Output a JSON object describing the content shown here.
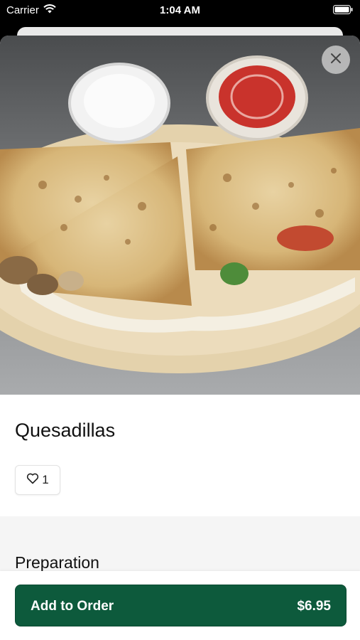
{
  "status_bar": {
    "carrier": "Carrier",
    "time": "1:04 AM"
  },
  "item": {
    "title": "Quesadillas",
    "likes": "1"
  },
  "section": {
    "title": "Preparation"
  },
  "order": {
    "label": "Add to Order",
    "price": "$6.95"
  },
  "colors": {
    "accent": "#0d5a3c",
    "background": "#ffffff",
    "section_bg": "#f5f5f5"
  },
  "icons": [
    "wifi-icon",
    "battery-icon",
    "close-icon",
    "heart-icon"
  ]
}
